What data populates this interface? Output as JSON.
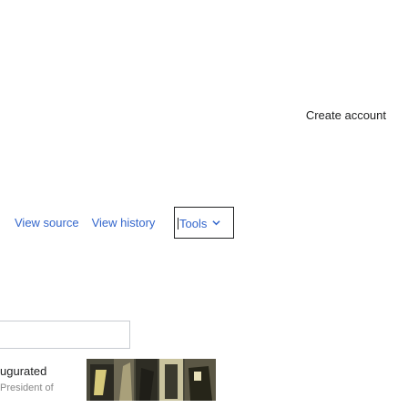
{
  "header": {
    "create_account": "Create account"
  },
  "view_tabs": [
    {
      "label": "View source"
    },
    {
      "label": "View history"
    }
  ],
  "tools_menu": {
    "label": "Tools",
    "icon": "chevron-down-icon"
  },
  "article": {
    "inaugurated_text": "ugurated",
    "sub_text": "President of"
  }
}
